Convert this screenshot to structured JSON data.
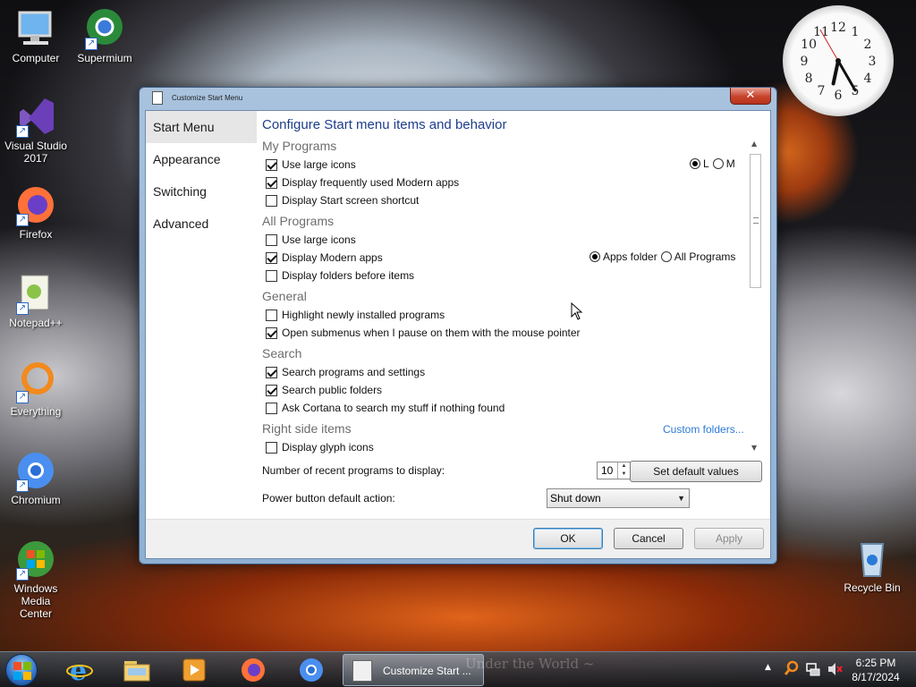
{
  "desktop": {
    "icons": [
      {
        "label": "Computer"
      },
      {
        "label": "Supermium"
      },
      {
        "label": "Visual Studio 2017"
      },
      {
        "label": "Firefox"
      },
      {
        "label": "Notepad++"
      },
      {
        "label": "Everything"
      },
      {
        "label": "Chromium"
      },
      {
        "label": "Windows Media Center"
      },
      {
        "label": "Recycle Bin"
      }
    ]
  },
  "clock": {
    "numbers": [
      "12",
      "1",
      "2",
      "3",
      "4",
      "5",
      "6",
      "7",
      "8",
      "9",
      "10",
      "11"
    ]
  },
  "dialog": {
    "title": "Customize Start Menu",
    "close_glyph": "✕",
    "nav": [
      {
        "label": "Start Menu"
      },
      {
        "label": "Appearance"
      },
      {
        "label": "Switching"
      },
      {
        "label": "Advanced"
      }
    ],
    "heading": "Configure Start menu items and behavior",
    "sections": {
      "my_programs": "My Programs",
      "all_programs": "All Programs",
      "general": "General",
      "search": "Search",
      "right_side": "Right side items"
    },
    "options": {
      "mp_large_icons": "Use large icons",
      "mp_modern_apps": "Display frequently used Modern apps",
      "mp_start_screen": "Display Start screen shortcut",
      "ap_large_icons": "Use large icons",
      "ap_modern_apps": "Display Modern apps",
      "ap_folders_first": "Display folders before items",
      "gen_highlight": "Highlight newly installed programs",
      "gen_submenus": "Open submenus when I pause on them with the mouse pointer",
      "srch_programs": "Search programs and settings",
      "srch_public": "Search public folders",
      "srch_cortana": "Ask Cortana to search my stuff if nothing found",
      "rs_glyph": "Display glyph icons"
    },
    "radios": {
      "size_l": "L",
      "size_m": "M",
      "apps_folder": "Apps folder",
      "all_programs": "All Programs"
    },
    "custom_folders_link": "Custom folders...",
    "recent_label": "Number of recent programs to display:",
    "recent_value": "10",
    "set_default_button": "Set default values",
    "power_label": "Power button default action:",
    "power_value": "Shut down",
    "ok_button": "OK",
    "cancel_button": "Cancel",
    "apply_button": "Apply"
  },
  "taskbar": {
    "active_task": "Customize Start ...",
    "watermark": "Under the World ~",
    "time": "6:25 PM",
    "date": "8/17/2024"
  }
}
